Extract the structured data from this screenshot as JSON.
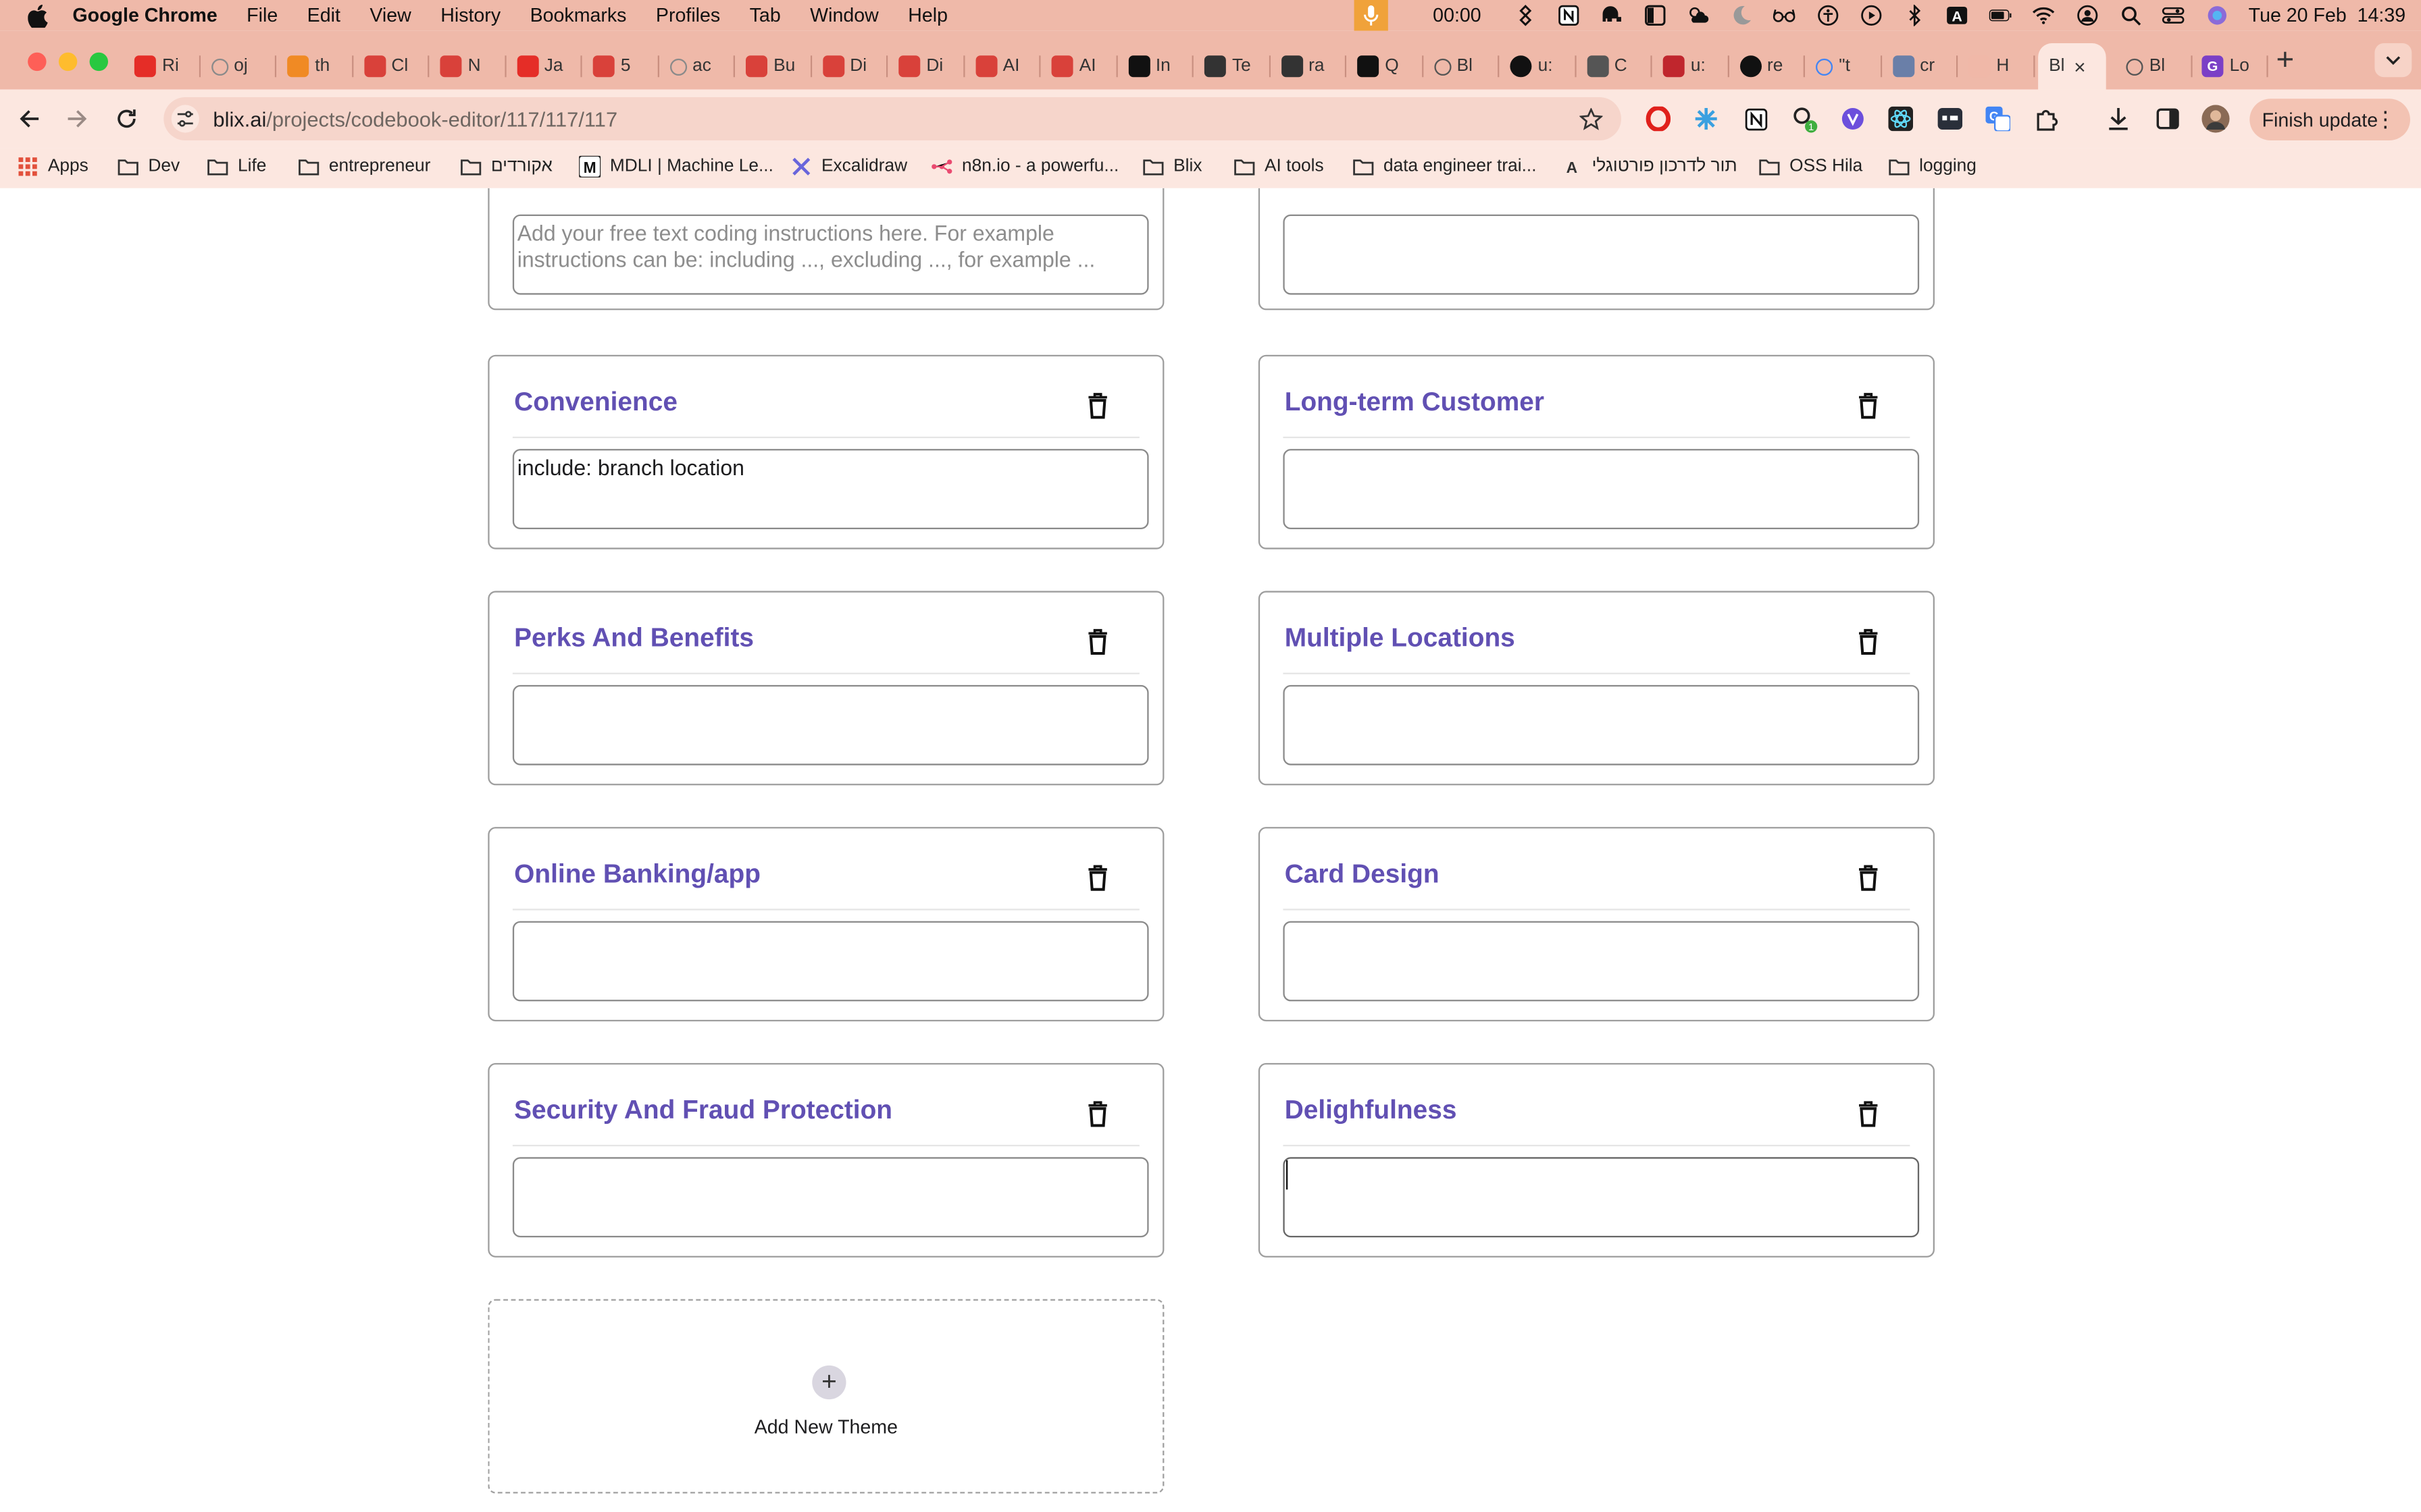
{
  "menubar": {
    "app_name": "Google Chrome",
    "items": [
      "File",
      "Edit",
      "View",
      "History",
      "Bookmarks",
      "Profiles",
      "Tab",
      "Window",
      "Help"
    ],
    "timer": "00:00",
    "datetime": "Tue 20 Feb  14:39"
  },
  "tabs": [
    {
      "label": "Ri",
      "color": "#e52d27",
      "icon": "youtube-icon"
    },
    {
      "label": "oj",
      "color": "#8a8a8a",
      "icon": "google-icon"
    },
    {
      "label": "th",
      "color": "#f08a24",
      "icon": "page-icon"
    },
    {
      "label": "Cl",
      "color": "#d9413a",
      "icon": "page-icon"
    },
    {
      "label": "N",
      "color": "#d9413a",
      "icon": "page-icon"
    },
    {
      "label": "Ja",
      "color": "#e52d27",
      "icon": "youtube-icon"
    },
    {
      "label": "5",
      "color": "#d9413a",
      "icon": "page-icon"
    },
    {
      "label": "ac",
      "color": "#8a8a8a",
      "icon": "google-icon"
    },
    {
      "label": "Bu",
      "color": "#d9413a",
      "icon": "page-icon"
    },
    {
      "label": "Di",
      "color": "#d9413a",
      "icon": "page-icon"
    },
    {
      "label": "Di",
      "color": "#d9413a",
      "icon": "page-icon"
    },
    {
      "label": "AI",
      "color": "#d9413a",
      "icon": "page-icon"
    },
    {
      "label": "AI",
      "color": "#d9413a",
      "icon": "page-icon"
    },
    {
      "label": "In",
      "color": "#111111",
      "icon": "page-icon"
    },
    {
      "label": "Te",
      "color": "#333333",
      "icon": "page-icon"
    },
    {
      "label": "ra",
      "color": "#333333",
      "icon": "page-icon"
    },
    {
      "label": "Q",
      "color": "#111111",
      "icon": "page-icon"
    },
    {
      "label": "Bl",
      "color": "#555555",
      "icon": "globe-icon"
    },
    {
      "label": "u:",
      "color": "#111111",
      "icon": "github-icon"
    },
    {
      "label": "C",
      "color": "#555555",
      "icon": "page-icon"
    },
    {
      "label": "u:",
      "color": "#c0262d",
      "icon": "page-icon"
    },
    {
      "label": "re",
      "color": "#111111",
      "icon": "github-icon"
    },
    {
      "label": "\"t",
      "color": "#4285f4",
      "icon": "google-icon"
    },
    {
      "label": "cr",
      "color": "#6a7fa8",
      "icon": "page-icon"
    },
    {
      "label": "H",
      "color": "#f0b8a8",
      "icon": "page-icon"
    }
  ],
  "active_tab": {
    "label": "Bl",
    "close": "×"
  },
  "trailing_tabs": [
    {
      "label": "Bl",
      "color": "#555555"
    },
    {
      "label": "Lo",
      "color": "#7b3fc6"
    }
  ],
  "toolbar": {
    "url_host": "blix.ai",
    "url_path": "/projects/codebook-editor/117/117/117",
    "finish_update": "Finish update"
  },
  "bookmarks": [
    {
      "label": "Apps",
      "icon": "apps-grid-icon"
    },
    {
      "label": "Dev",
      "icon": "folder-icon"
    },
    {
      "label": "Life",
      "icon": "folder-icon"
    },
    {
      "label": "entrepreneur",
      "icon": "folder-icon"
    },
    {
      "label": "אקורדים",
      "icon": "folder-icon"
    },
    {
      "label": "MDLI | Machine Le...",
      "icon": "mdli-icon"
    },
    {
      "label": "Excalidraw",
      "icon": "excalidraw-icon"
    },
    {
      "label": "n8n.io - a powerfu...",
      "icon": "n8n-icon"
    },
    {
      "label": "Blix",
      "icon": "folder-icon"
    },
    {
      "label": "AI tools",
      "icon": "folder-icon"
    },
    {
      "label": "data engineer trai...",
      "icon": "folder-icon"
    },
    {
      "label": "תור לדרכון פורטוגלי",
      "icon": "page-icon"
    },
    {
      "label": "OSS Hila",
      "icon": "folder-icon"
    },
    {
      "label": "logging",
      "icon": "folder-icon"
    }
  ],
  "top_partial": {
    "left_placeholder": "Add your free text coding instructions here. For example instructions can be: including ..., excluding ..., for example ...",
    "right_value": ""
  },
  "themes": [
    {
      "title": "Convenience",
      "value": "include: branch location"
    },
    {
      "title": "Long-term Customer",
      "value": ""
    },
    {
      "title": "Perks And Benefits",
      "value": ""
    },
    {
      "title": "Multiple Locations",
      "value": ""
    },
    {
      "title": "Online Banking/app",
      "value": ""
    },
    {
      "title": "Card Design",
      "value": ""
    },
    {
      "title": "Security And Fraud Protection",
      "value": ""
    },
    {
      "title": "Delighfulness",
      "value": ""
    }
  ],
  "add_theme": {
    "label": "Add New Theme",
    "plus": "+"
  },
  "colors": {
    "chrome_frame": "#efb9a9",
    "toolbar_bg": "#fce7e0",
    "theme_title": "#6150b3",
    "card_border": "#9e9e9e"
  }
}
